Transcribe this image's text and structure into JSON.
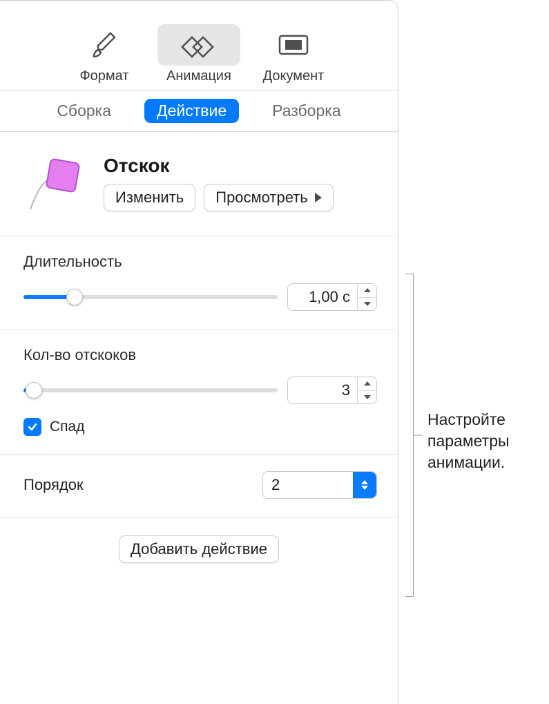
{
  "toolbar": {
    "format": "Формат",
    "animation": "Анимация",
    "document": "Документ"
  },
  "subtabs": {
    "build_in": "Сборка",
    "action": "Действие",
    "build_out": "Разборка"
  },
  "effect": {
    "title": "Отскок",
    "change_btn": "Изменить",
    "preview_btn": "Просмотреть"
  },
  "duration": {
    "label": "Длительность",
    "value": "1,00 с",
    "slider_percent": 20
  },
  "bounces": {
    "label": "Кол-во отскоков",
    "value": "3",
    "slider_percent": 4,
    "decay_label": "Спад",
    "decay_checked": true
  },
  "order": {
    "label": "Порядок",
    "value": "2"
  },
  "footer": {
    "add_action": "Добавить действие"
  },
  "callout": {
    "text": "Настройте параметры анимации."
  }
}
